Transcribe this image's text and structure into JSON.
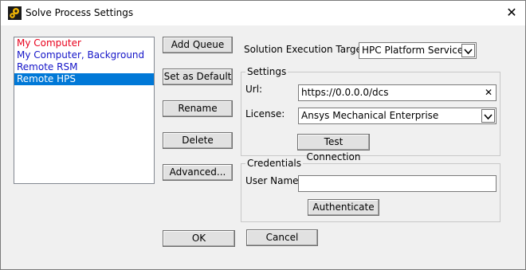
{
  "window": {
    "title": "Solve Process Settings",
    "close_glyph": "✕"
  },
  "queues": [
    {
      "label": "My Computer",
      "color": "#e8001c",
      "selected": false
    },
    {
      "label": "My Computer, Background",
      "color": "#1414c8",
      "selected": false
    },
    {
      "label": "Remote RSM",
      "color": "#1414c8",
      "selected": false
    },
    {
      "label": "Remote HPS",
      "color": "#ffffff",
      "selected": true
    }
  ],
  "colors": {
    "selection": "#0078d7"
  },
  "buttons": {
    "add_queue": "Add Queue",
    "set_default": "Set as Default",
    "rename": "Rename",
    "delete": "Delete",
    "advanced": "Advanced...",
    "ok": "OK",
    "cancel": "Cancel",
    "test_connection": "Test Connection",
    "authenticate": "Authenticate"
  },
  "target": {
    "label": "Solution Execution Target:",
    "value": "HPC Platform Services"
  },
  "settings": {
    "group_label": "Settings",
    "url_label": "Url:",
    "url_value": "https://0.0.0.0/dcs",
    "clear_glyph": "✕",
    "license_label": "License:",
    "license_value": "Ansys Mechanical Enterprise"
  },
  "credentials": {
    "group_label": "Credentials",
    "username_label": "User Name:",
    "username_value": ""
  }
}
